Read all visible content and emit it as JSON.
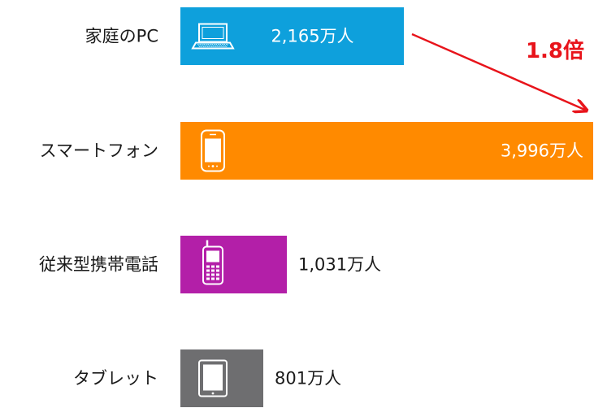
{
  "chart_data": {
    "type": "bar",
    "orientation": "horizontal",
    "categories": [
      "家庭のPC",
      "スマートフォン",
      "従来型携帯電話",
      "タブレット"
    ],
    "values": [
      2165,
      3996,
      1031,
      801
    ],
    "value_labels": [
      "2,165万人",
      "3,996万人",
      "1,031万人",
      "801万人"
    ],
    "unit": "万人",
    "colors": [
      "#0ea0dc",
      "#ff8a00",
      "#b31fa8",
      "#6e6e70"
    ],
    "icons": [
      "laptop-icon",
      "smartphone-icon",
      "feature-phone-icon",
      "tablet-icon"
    ],
    "annotation": {
      "text": "1.8倍",
      "color": "#e8141b",
      "from_category": "家庭のPC",
      "to_category": "スマートフォン"
    },
    "grid": false,
    "legend": "none"
  }
}
